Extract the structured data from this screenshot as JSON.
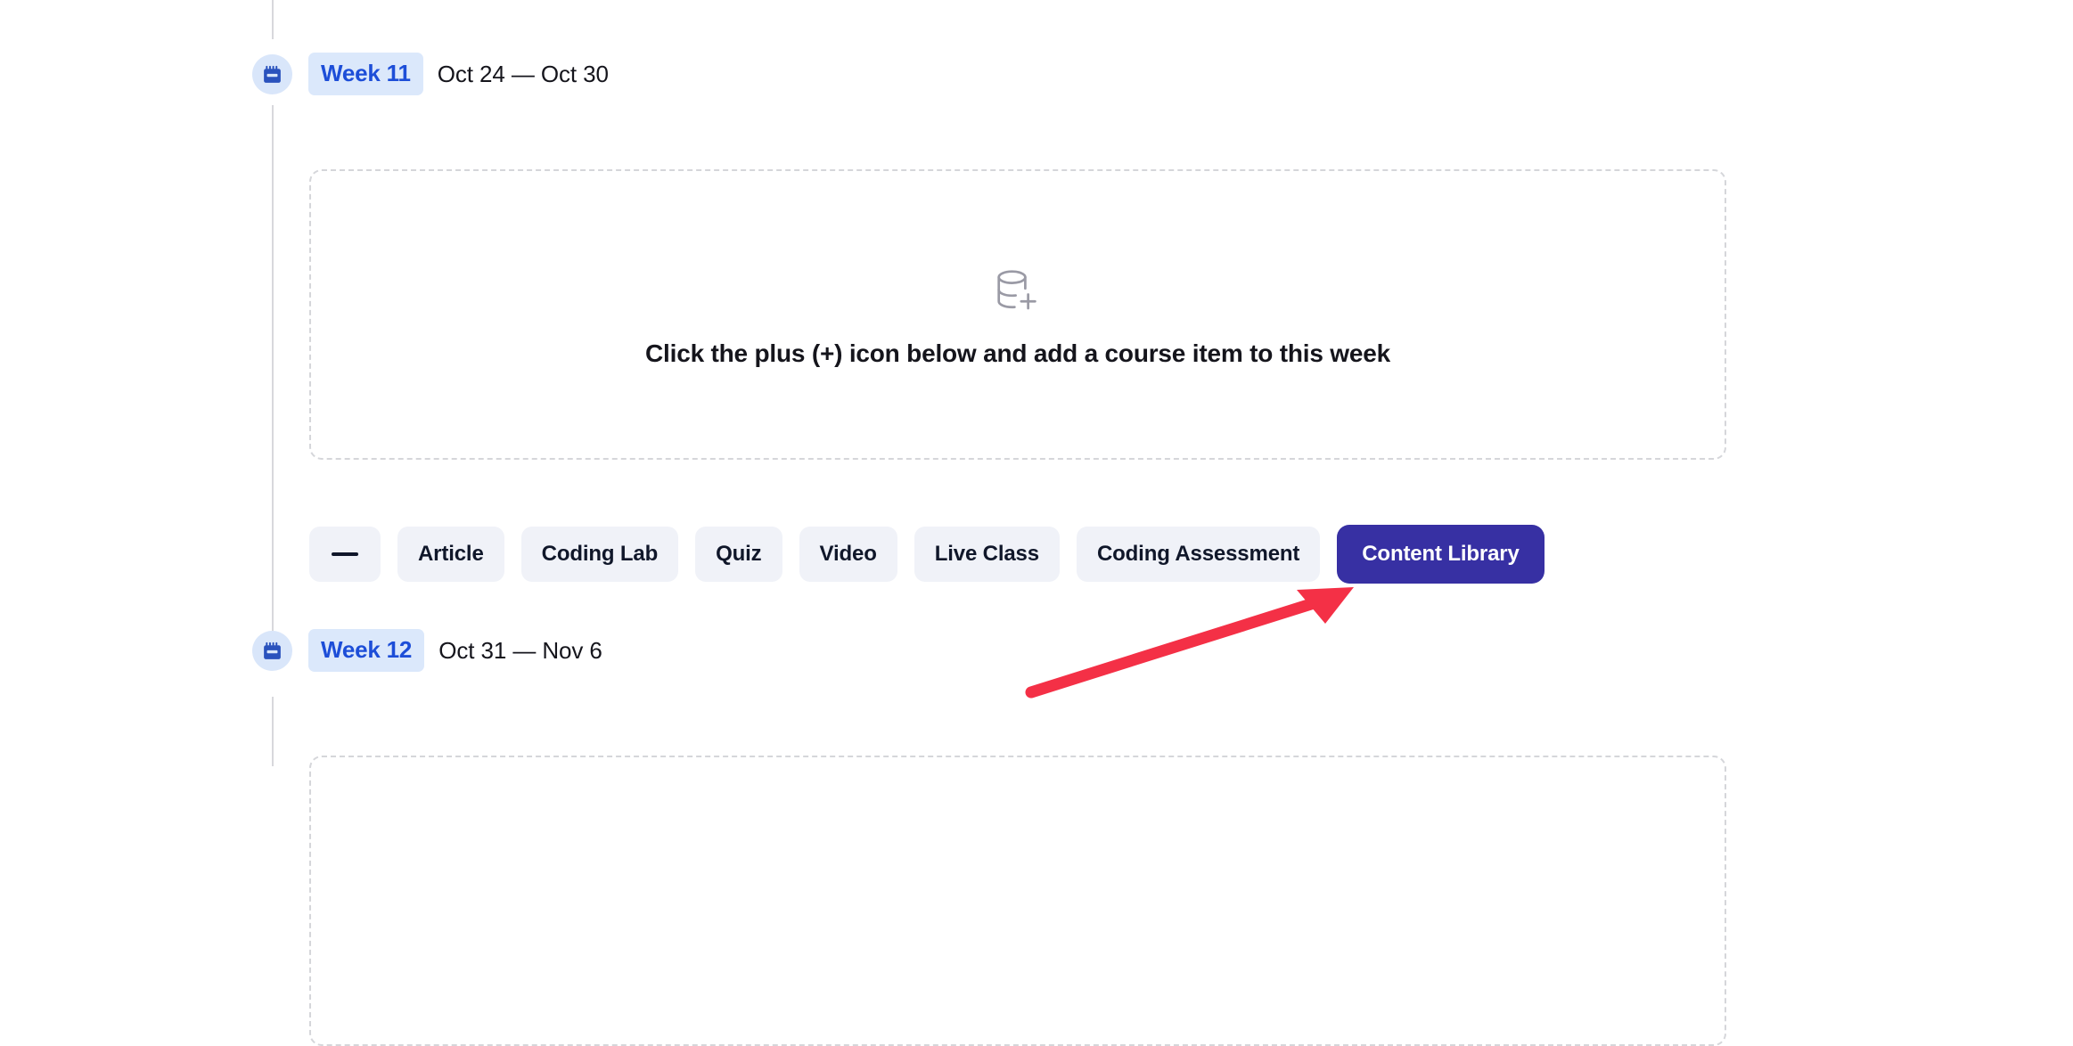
{
  "colors": {
    "accent_blue": "#1d4ed8",
    "badge_bg": "#dbe8fb",
    "icon_bubble_bg": "#d9e6fa",
    "chip_bg": "#f0f2f8",
    "chip_text": "#10172a",
    "primary_btn_bg": "#3730a3",
    "primary_btn_text": "#ffffff",
    "dashed_border": "#d5d6da",
    "rail": "#d8d8dc",
    "empty_icon": "#9a9aa5",
    "annotation_arrow": "#f43046"
  },
  "weeks": [
    {
      "icon": "calendar-icon",
      "badge": "Week 11",
      "dates": "Oct 24 — Oct 30",
      "empty_state": {
        "icon": "database-plus-icon",
        "message": "Click the plus (+) icon below and add a course item to this week"
      }
    },
    {
      "icon": "calendar-icon",
      "badge": "Week 12",
      "dates": "Oct 31 — Nov 6",
      "empty_state": {
        "icon": "database-plus-icon",
        "message": ""
      }
    }
  ],
  "item_buttons": [
    {
      "name": "collapse",
      "label": "—",
      "icon": "minus-icon",
      "primary": false
    },
    {
      "name": "article",
      "label": "Article",
      "primary": false
    },
    {
      "name": "coding-lab",
      "label": "Coding Lab",
      "primary": false
    },
    {
      "name": "quiz",
      "label": "Quiz",
      "primary": false
    },
    {
      "name": "video",
      "label": "Video",
      "primary": false
    },
    {
      "name": "live-class",
      "label": "Live Class",
      "primary": false
    },
    {
      "name": "coding-assessment",
      "label": "Coding Assessment",
      "primary": false
    },
    {
      "name": "content-library",
      "label": "Content Library",
      "primary": true
    }
  ],
  "annotation": {
    "type": "arrow",
    "points_to": "Content Library",
    "color": "#f43046"
  }
}
